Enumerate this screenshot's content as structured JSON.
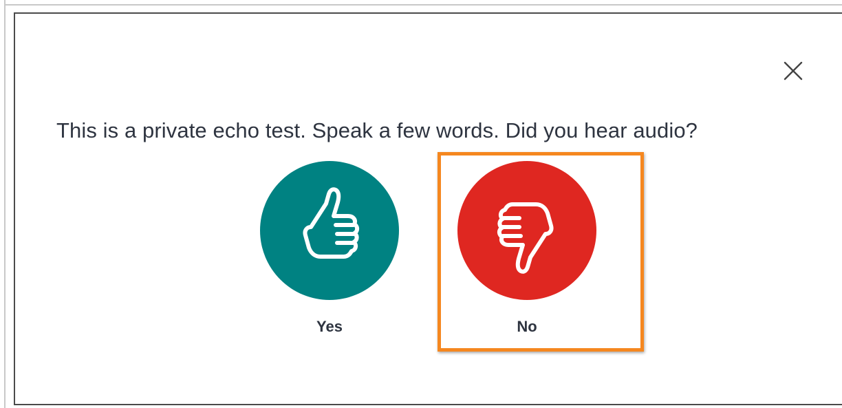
{
  "dialog": {
    "prompt": "This is a private echo test. Speak a few words. Did you hear audio?",
    "close_icon": "close-icon"
  },
  "options": {
    "yes": {
      "label": "Yes",
      "icon": "thumbs-up-icon",
      "color": "#008282"
    },
    "no": {
      "label": "No",
      "icon": "thumbs-down-icon",
      "color": "#df2721"
    }
  },
  "highlight": {
    "color": "#f5871f",
    "target": "No"
  }
}
